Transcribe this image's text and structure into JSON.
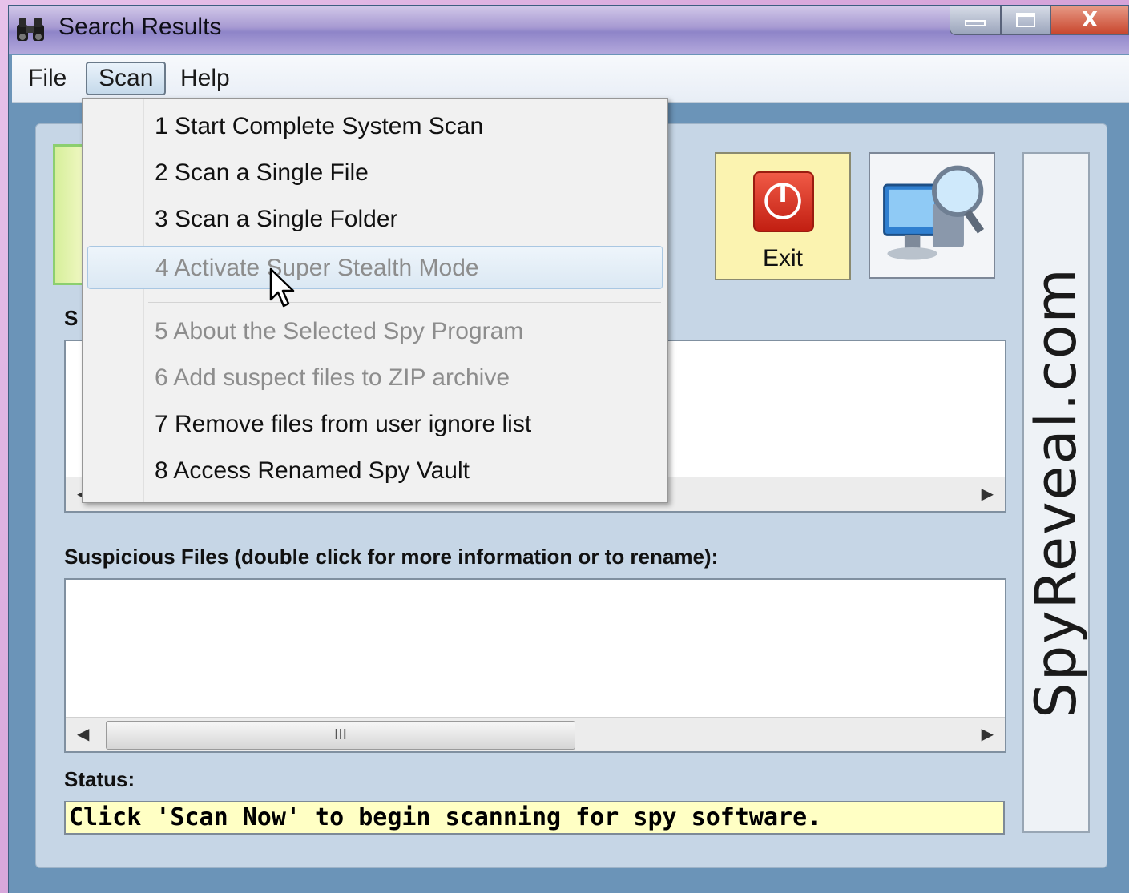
{
  "window": {
    "title": "Search Results",
    "controls": {
      "minimize": "minimize",
      "maximize": "maximize",
      "close": "X"
    }
  },
  "menubar": {
    "file": "File",
    "scan": "Scan",
    "help": "Help"
  },
  "scan_menu": {
    "items": [
      {
        "label": "1 Start Complete System Scan",
        "enabled": true
      },
      {
        "label": "2 Scan a Single File",
        "enabled": true
      },
      {
        "label": "3 Scan a Single Folder",
        "enabled": true
      },
      {
        "label": "4 Activate Super Stealth Mode",
        "enabled": false,
        "hovered": true
      },
      {
        "label": "5 About the Selected Spy Program",
        "enabled": false
      },
      {
        "label": "6 Add suspect files to ZIP archive",
        "enabled": false
      },
      {
        "label": "7 Remove files from user ignore list",
        "enabled": true
      },
      {
        "label": "8 Access Renamed Spy Vault",
        "enabled": true
      }
    ]
  },
  "toolbar": {
    "exit_label": "Exit"
  },
  "brand": {
    "vertical_text": "SpyReveal.com"
  },
  "sections": {
    "spy_list_label_partial": "S",
    "suspicious_label": "Suspicious Files (double click for more information or to rename):",
    "scroll_thumb_glyph": "III",
    "status_label": "Status:",
    "status_text": "Click 'Scan Now' to begin scanning for spy software."
  },
  "icons": {
    "title": "binoculars-icon",
    "exit": "power-icon",
    "scan": "computer-magnifier-icon"
  }
}
